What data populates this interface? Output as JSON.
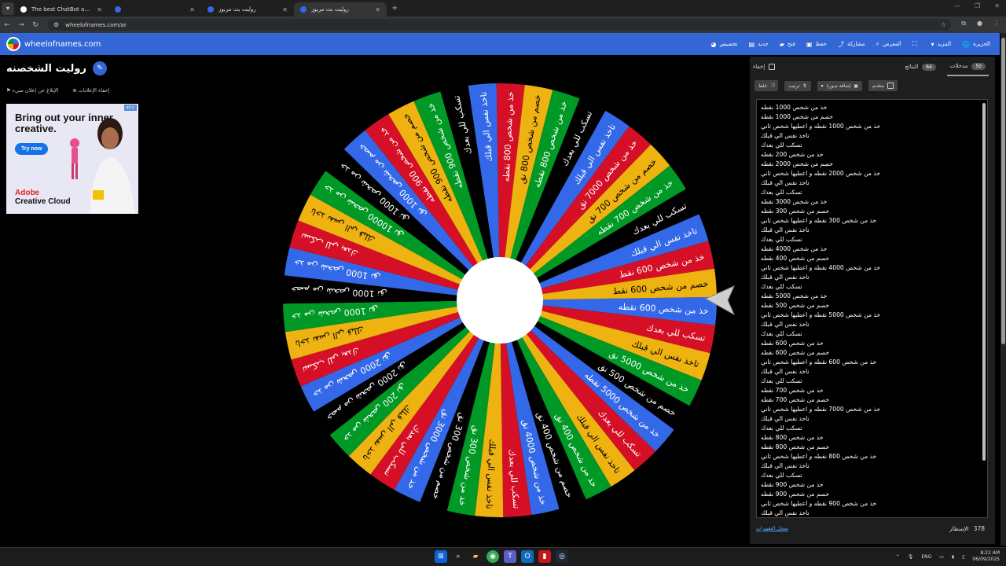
{
  "browser": {
    "tabs": [
      {
        "title": "The best ChatBot and Widgets",
        "active": false,
        "color": "#ffffff"
      },
      {
        "title": "",
        "active": false,
        "color": "#3369e8"
      },
      {
        "title": "روليت بث مربوز",
        "active": false,
        "color": "#3369e8"
      },
      {
        "title": "روليت بث مربوز",
        "active": true,
        "color": "#3369e8"
      }
    ],
    "url": "wheelofnames.com/ar"
  },
  "site": {
    "name": "wheelofnames.com",
    "menu": [
      {
        "label": "الحزيرة",
        "icon": "globe-icon"
      },
      {
        "label": "المزيد",
        "icon": "chevron-down-icon"
      },
      {
        "label": "",
        "icon": "fullscreen-icon"
      },
      {
        "label": "المعرض",
        "icon": "search-icon"
      },
      {
        "label": "مشاركة",
        "icon": "share-icon"
      },
      {
        "label": "حفظ",
        "icon": "save-icon"
      },
      {
        "label": "فتح",
        "icon": "folder-icon"
      },
      {
        "label": "جديد",
        "icon": "file-icon"
      },
      {
        "label": "تخصيص",
        "icon": "palette-icon"
      }
    ]
  },
  "page": {
    "title": "روليت الشخصنه",
    "hide_ads": "إخفاء الإعلانات",
    "report_ad": "الإبلاغ عن إعلان سيء"
  },
  "ad": {
    "headline": "Bring out your inner creative.",
    "cta": "Try now",
    "brand_line1": "Adobe",
    "brand_line2": "Creative Cloud",
    "badge": "ad ▷"
  },
  "wheel": {
    "colors": [
      "#3369e8",
      "#d50f25",
      "#eeb211",
      "#009925",
      "#000000"
    ],
    "slice_labels": [
      "خذ من شخص 600 نقطه",
      "تسكب للي بعدك",
      "تاخذ نفس الي قبلك",
      "خذ من شخص 5000 نق",
      "خصم من شخص 500 نق",
      "خذ من شخص 5000 نقطه",
      "تسكب للي بعدك",
      "تاخذ نفس الي قبلك",
      "خذ من شخص 400 نق",
      "خصم من شخص 400 نق",
      "خذ من شخص 4000 نق",
      "تسكب للي بعدك",
      "تاخذ نفس الي قبلك",
      "خذ من شخص 300 نق",
      "خصم من شخص 300 نق",
      "خذ من شخص 3000 نق",
      "تسكب للي بعدك",
      "تاخذ نفس الي قبلك",
      "خذ من شخص 200 نق",
      "خصم من شخص 2000 نق",
      "خذ من شخص 2000 نق",
      "تسكب للي بعدك",
      "تاخذ نفس الي قبلك",
      "خذ من شخص 1000 نق",
      "خصم من شخص 1000 نق",
      "خذ من شخص 1000 نق",
      "تسكب للي بعدك",
      "تاخذ نفس الي قبلك",
      "خذ من شخص 10000 نق",
      "خذ من شخص 1000 نق",
      "خصم من شخص 1000 نق",
      "خذ من شخص 900 نقطه",
      "خصم من شخص 900 نقطه",
      "خذ من شخص 900 نقطه",
      "تسكب للي بعدك",
      "تاخذ نفس الي قبلك",
      "خذ من شخص 800 نقطه",
      "خصم من شخص 800 نق",
      "خذ من شخص 800 نقطه",
      "تسكب للي بعدك",
      "تاخذ نفس الي قبلك",
      "خذ من شخص 7000 نق",
      "خصم من شخص 700 نق",
      "خذ من شخص 700 نقطه",
      "تسكب للي بعدك",
      "تاخذ نفس الي قبلك",
      "خذ من شخص 600 نقط",
      "خصم من شخص 600 نقط"
    ]
  },
  "panel": {
    "tabs": [
      {
        "label": "مدخلات",
        "count": "50",
        "active": true
      },
      {
        "label": "النتائج",
        "count": "64",
        "active": false
      }
    ],
    "hide_label": "إخفاء",
    "toolbar": {
      "shuffle": "خلط",
      "sort": "ترتيب",
      "add_image": "إضافة صورة",
      "advanced": "متقدم"
    },
    "entries": [
      "خذ من شخص 1000 نقطه",
      "خصم من شخص 1000 نقطه",
      "خذ من شخص 1000 نقطه و اعطيها شخص ثاني",
      "تاخذ نفس الي قبلك",
      "تسكب للي بعدك",
      "خذ من شخص 200 نقطه",
      "خصم من شخص 2000 نقطه",
      "خذ من شخص 2000 نقطه و اعطيها شخص ثاني",
      "تاخذ نفس الي قبلك",
      "تسكب للي بعدك",
      "خذ من شخص 3000 نقطه",
      "خصم من شخص 300 نقطه",
      "خذ من شخص 300 نقطه و اعطيها شخص ثاني",
      "تاخذ نفس الي قبلك",
      "تسكب للي بعدك",
      "خذ من شخص 4000 نقطه",
      "خصم من شخص 400 نقطه",
      "خذ من شخص 4000 نقطه و اعطيها شخص ثاني",
      "تاخذ نفس الي قبلك",
      "تسكب للي بعدك",
      "خذ من شخص 5000 نقطه",
      "خصم من شخص 500 نقطه",
      "خذ من شخص 5000 نقطه و اعطيها شخص ثاني",
      "تاخذ نفس الي قبلك",
      "تسكب للي بعدك",
      "خذ من شخص 600 نقطه",
      "خصم من شخص 600 نقطه",
      "خذ من شخص 600 نقطه و اعطيها شخص ثاني",
      "تاخذ نفس الي قبلك",
      "تسكب للي بعدك",
      "خذ من شخص 700 نقطه",
      "خصم من شخص 700 نقطه",
      "خذ من شخص 7000 نقطه و اعطيها شخص ثاني",
      "تاخذ نفس الي قبلك",
      "تسكب للي بعدك",
      "خذ من شخص 800 نقطه",
      "خصم من شخص 800 نقطه",
      "خذ من شخص 800 نقطه و اعطيها شخص ثاني",
      "تاخذ نفس الي قبلك",
      "تسكب للي بعدك",
      "خذ من شخص 900 نقطه",
      "خصم من شخص 900 نقطه",
      "خذ من شخص 900 نقطه و اعطيها شخص ثاني",
      "تاخذ نفس الي قبلك"
    ],
    "version_link": "سجل التغييرات",
    "lines_label": "الإسطار",
    "lines_count": "378"
  },
  "taskbar": {
    "lang": "ENG",
    "time": "8:22 AM",
    "date": "06/09/2025"
  }
}
